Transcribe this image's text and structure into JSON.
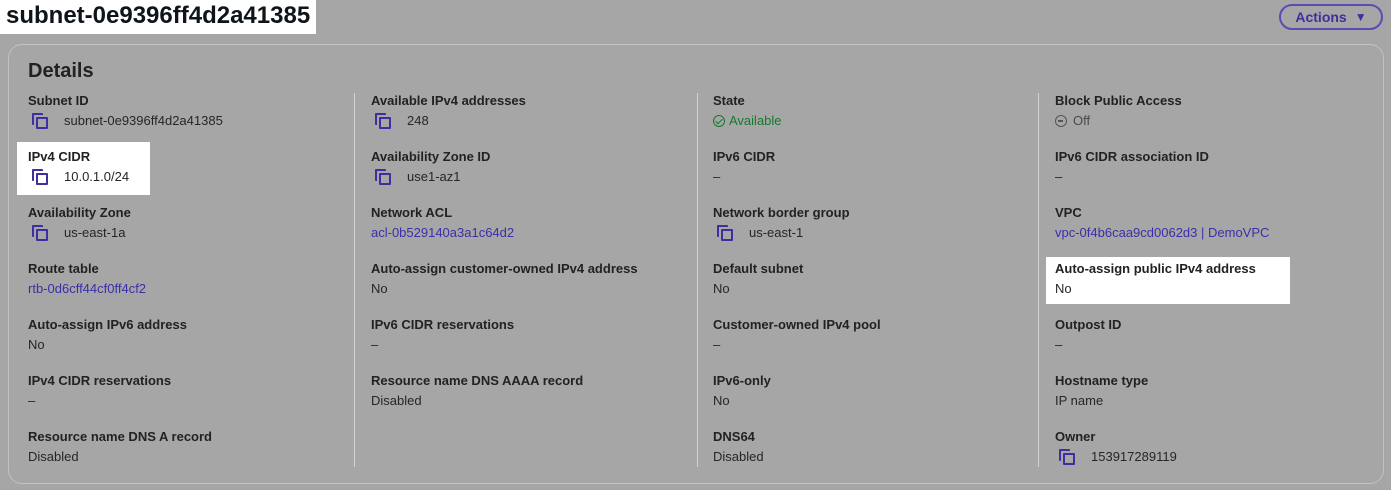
{
  "header": {
    "subnet_title": "subnet-0e9396ff4d2a41385",
    "actions_label": "Actions",
    "actions_caret": "▼"
  },
  "details": {
    "title": "Details",
    "columns": [
      [
        {
          "label": "Subnet ID",
          "value": "subnet-0e9396ff4d2a41385",
          "copy": true
        },
        {
          "label": "IPv4 CIDR",
          "value": "10.0.1.0/24",
          "copy": true
        },
        {
          "label": "Availability Zone",
          "value": "us-east-1a",
          "copy": true
        },
        {
          "label": "Route table",
          "value": "rtb-0d6cff44cf0ff4cf2",
          "link": true
        },
        {
          "label": "Auto-assign IPv6 address",
          "value": "No"
        },
        {
          "label": "IPv4 CIDR reservations",
          "value": "–"
        },
        {
          "label": "Resource name DNS A record",
          "value": "Disabled"
        }
      ],
      [
        {
          "label": "Available IPv4 addresses",
          "value": "248",
          "copy": true
        },
        {
          "label": "Availability Zone ID",
          "value": "use1-az1",
          "copy": true
        },
        {
          "label": "Network ACL",
          "value": "acl-0b529140a3a1c64d2",
          "link": true
        },
        {
          "label": "Auto-assign customer-owned IPv4 address",
          "value": "No"
        },
        {
          "label": "IPv6 CIDR reservations",
          "value": "–"
        },
        {
          "label": "Resource name DNS AAAA record",
          "value": "Disabled"
        }
      ],
      [
        {
          "label": "State",
          "value": "Available",
          "status": "ok"
        },
        {
          "label": "IPv6 CIDR",
          "value": "–"
        },
        {
          "label": "Network border group",
          "value": "us-east-1",
          "copy": true
        },
        {
          "label": "Default subnet",
          "value": "No"
        },
        {
          "label": "Customer-owned IPv4 pool",
          "value": "–"
        },
        {
          "label": "IPv6-only",
          "value": "No"
        },
        {
          "label": "DNS64",
          "value": "Disabled"
        }
      ],
      [
        {
          "label": "Block Public Access",
          "value": "Off",
          "status": "off"
        },
        {
          "label": "IPv6 CIDR association ID",
          "value": "–"
        },
        {
          "label": "VPC",
          "value": "vpc-0f4b6caa9cd0062d3 | DemoVPC",
          "link": true
        },
        {
          "label": "Auto-assign public IPv4 address",
          "value": "No"
        },
        {
          "label": "Outpost ID",
          "value": "–"
        },
        {
          "label": "Hostname type",
          "value": "IP name"
        },
        {
          "label": "Owner",
          "value": "153917289119",
          "copy": true
        }
      ]
    ]
  },
  "colors": {
    "background": "#a6a6a6",
    "accent": "#3d2fa0",
    "success": "#137a2e"
  }
}
